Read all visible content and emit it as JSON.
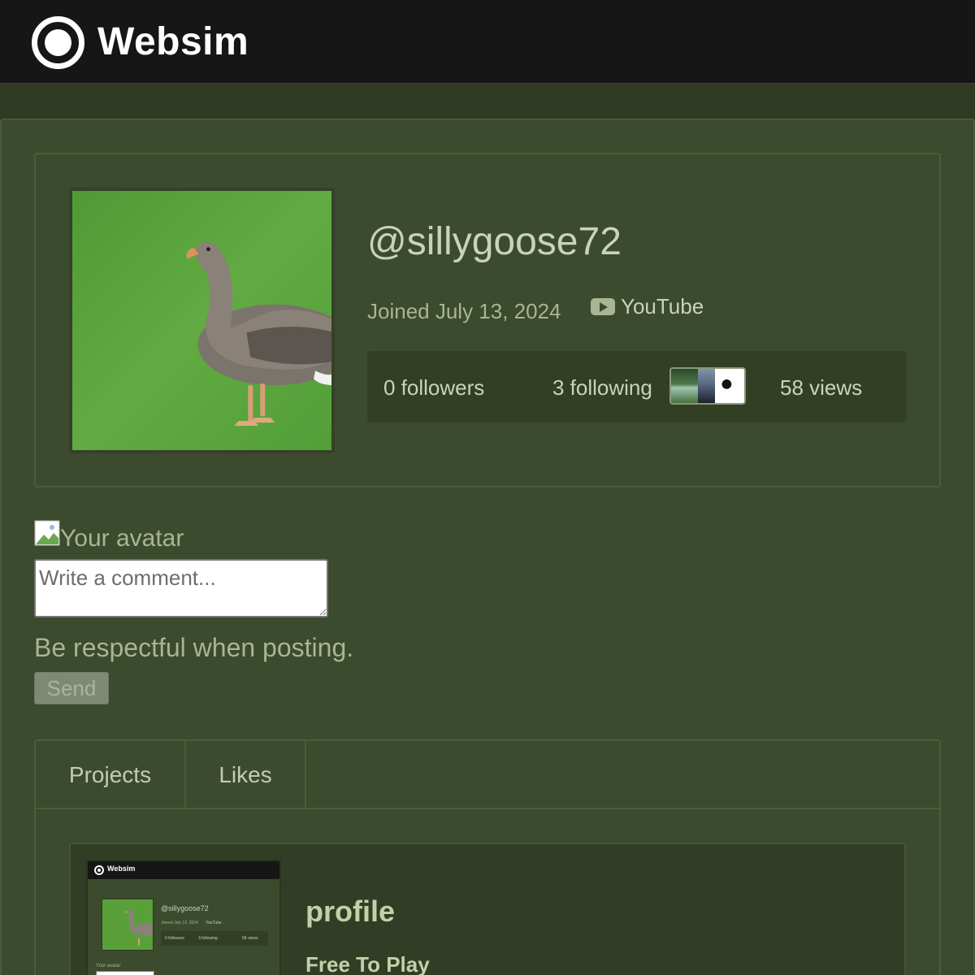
{
  "header": {
    "app_name": "Websim"
  },
  "profile": {
    "username": "@sillygoose72",
    "joined": "Joined July 13, 2024",
    "social_link": "YouTube",
    "stats": {
      "followers": "0 followers",
      "following": "3 following",
      "views": "58 views"
    },
    "avatar_alt": "profile avatar of a goose"
  },
  "comment": {
    "avatar_alt": "Your avatar",
    "placeholder": "Write a comment...",
    "guideline": "Be respectful when posting.",
    "send_label": "Send"
  },
  "tabs": [
    {
      "label": "Projects"
    },
    {
      "label": "Likes"
    }
  ],
  "projects": [
    {
      "title": "profile",
      "tag": "Free To Play",
      "thumbnail": {
        "app_name": "Websim",
        "username": "@sillygoose72",
        "joined": "Joined July 13, 2024",
        "social_link": "YouTube",
        "followers": "0 followers",
        "following": "3 following",
        "views": "58 views",
        "comment_avatar": "Your avatar"
      }
    }
  ],
  "colors": {
    "background": "#3c4a2d",
    "topbar": "#161616",
    "accent_text": "#c2d1a8"
  }
}
